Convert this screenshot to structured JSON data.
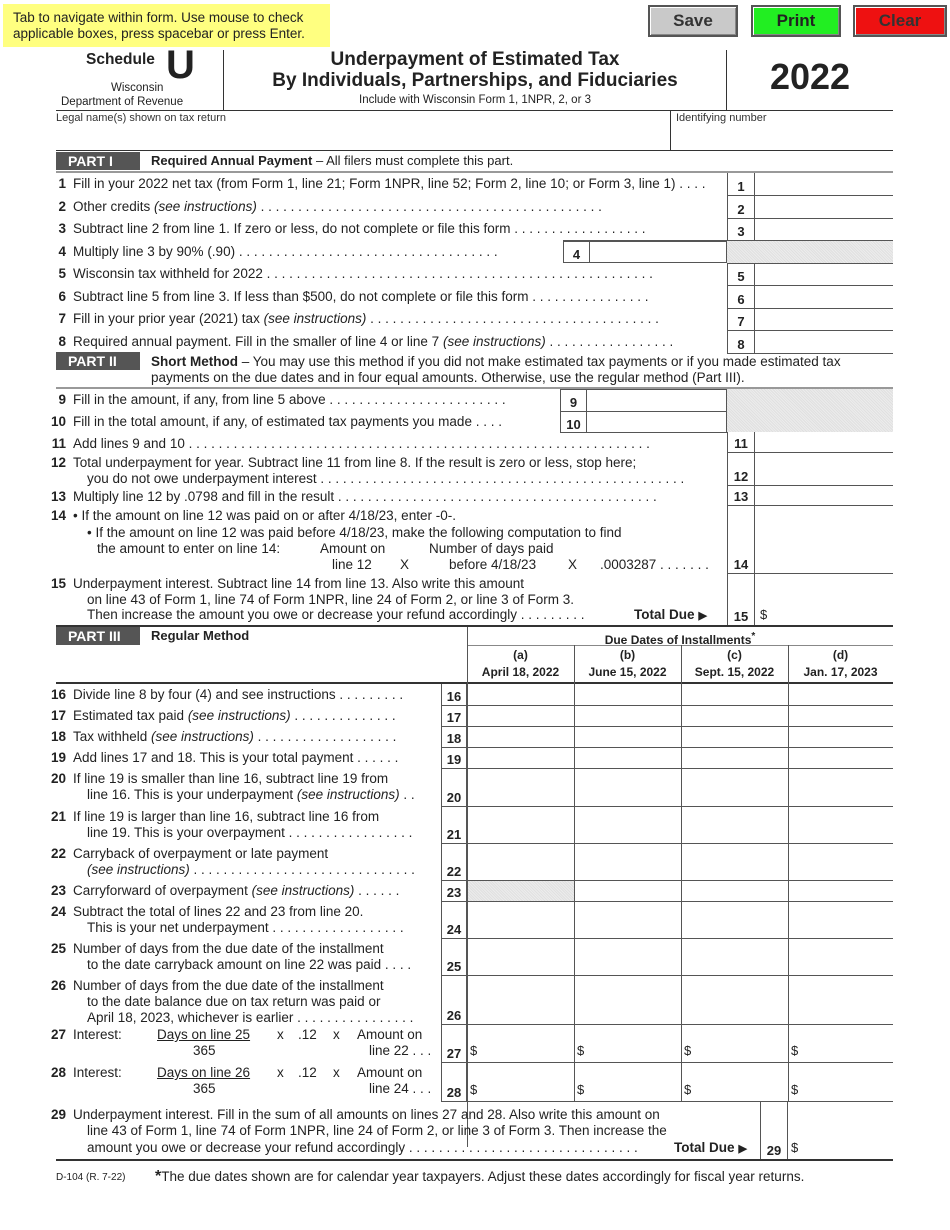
{
  "banner": "Tab to navigate within form. Use mouse to check applicable boxes, press spacebar or press Enter.",
  "buttons": {
    "save": "Save",
    "print": "Print",
    "clear": "Clear"
  },
  "buttonColors": {
    "save": "#c9c9c9",
    "print": "#22ee22",
    "clear": "#ee1111"
  },
  "header": {
    "schedule_word": "Schedule",
    "schedule_letter": "U",
    "state": "Wisconsin",
    "department": "Department of Revenue",
    "title_line1": "Underpayment of Estimated Tax",
    "title_line2": "By Individuals, Partnerships, and Fiduciaries",
    "subtitle": "Include with Wisconsin Form 1, 1NPR, 2, or 3",
    "year": "2022"
  },
  "fields": {
    "legal_name_label": "Legal name(s) shown on tax return",
    "legal_name_value": "",
    "id_label": "Identifying number",
    "id_value": ""
  },
  "part1": {
    "tag": "PART I",
    "title_bold": "Required Annual Payment",
    "title_rest": " – All filers must complete this part.",
    "lines": [
      {
        "num": "1",
        "text": "Fill in your 2022 net tax (from Form 1, line 21; Form 1NPR, line 52; Form 2, line 10; or Form 3, line 1) . . . .",
        "value": ""
      },
      {
        "num": "2",
        "text": "Other credits ",
        "italic": "(see instructions)",
        "dots": " . . . . . . . . . . . . . . . . . . . . . . . . . . . . . . . . . . . . . . . . . . . . . .",
        "value": ""
      },
      {
        "num": "3",
        "text": "Subtract line 2 from line 1.  If zero or less, do not complete or file this form  . . . . . . . . . . . . . . . . . .",
        "value": ""
      },
      {
        "num": "4",
        "text": "Multiply line 3 by 90% (.90) . . . . . . . . . . . . . . . . . . . . . . . . . . . . . . . . . . .",
        "value": ""
      },
      {
        "num": "5",
        "text": "Wisconsin tax withheld for 2022 . . . . . . . . . . . . . . . . . . . . . . . . . . . . . . . . . . . . . . . . . . . . . . . . . . . .",
        "value": ""
      },
      {
        "num": "6",
        "text": "Subtract line 5 from line 3.  If less than $500, do not complete or file this form  . . . . . . . . . . . . . . . .",
        "value": ""
      },
      {
        "num": "7",
        "text": "Fill in your prior year (2021) tax ",
        "italic": "(see instructions)",
        "dots": "  . . . . . . . . . . . . . . . . . . . . . . . . . . . . . . . . . . . . . . .",
        "value": ""
      },
      {
        "num": "8",
        "text": "Required annual payment.  Fill in the smaller of line 4 or line 7 ",
        "italic": "(see instructions)",
        "dots": " . . . . . . . . . . . . . . . . .",
        "value": ""
      }
    ]
  },
  "part2": {
    "tag": "PART II",
    "title_bold": "Short Method",
    "title_rest1": " – You may use this method if you did not make estimated tax payments or if you made estimated tax",
    "title_rest2": "payments on the due dates and in four equal amounts.  Otherwise, use the regular method (Part III).",
    "lines": [
      {
        "num": "9",
        "text": "Fill in the amount, if any, from line 5 above . . . . . . . . . . . . . . . . . . . . . . . .",
        "value": ""
      },
      {
        "num": "10",
        "text": "Fill in the total amount, if any, of estimated tax payments you made  . . . .",
        "value": ""
      },
      {
        "num": "11",
        "text": "Add lines 9 and 10  . . . . . . . . . . . . . . . . . . . . . . . . . . . . . . . . . . . . . . . . . . . . . . . . . . . . . . . . . . . . . .",
        "value": ""
      },
      {
        "num": "12",
        "text": "Total underpayment for year. Subtract line 11 from line 8. If the result is zero or less, stop here;",
        "text2": "you do not owe underpayment interest . . . . . . . . . . . . . . . . . . . . . . . . . . . . . . . . . . . . . . . . . . . . . . . . .",
        "value": ""
      },
      {
        "num": "13",
        "text": "Multiply line 12 by .0798 and fill in the result  . . . . . . . . . . . . . . . . . . . . . . . . . . . . . . . . . . . . . . . . . . .",
        "value": ""
      },
      {
        "num": "14",
        "bullet1": "• If the amount on line 12 was paid on or after 4/18/23, enter -0-.",
        "bullet2": "• If the amount on line 12 was paid before 4/18/23, make the following computation to find",
        "bullet2b": "the amount to enter on line 14:",
        "calc_amount_top": "Amount on",
        "calc_amount_bottom": "line 12",
        "calc_x1": "X",
        "calc_days_top": "Number of days paid",
        "calc_days_bottom": "before 4/18/23",
        "calc_x2": "X",
        "calc_rate": ".0003287  . . . . . . .",
        "value": ""
      },
      {
        "num": "15",
        "text": "Underpayment interest. Subtract line 14 from line 13. Also write this amount",
        "text2": "on line 43 of Form 1, line 74 of Form 1NPR, line 24 of Form 2, or line 3 of Form 3.",
        "text3": "Then increase the amount you owe or decrease your refund accordingly  . . . . . . . . .",
        "total_due": "Total Due",
        "dollar": "$",
        "value": ""
      }
    ]
  },
  "part3": {
    "tag": "PART III",
    "title": "Regular Method",
    "due_dates_header": "Due Dates of Installments",
    "asterisk": "*",
    "columns": [
      {
        "letter": "(a)",
        "date": "April 18, 2022"
      },
      {
        "letter": "(b)",
        "date": "June 15, 2022"
      },
      {
        "letter": "(c)",
        "date": "Sept. 15, 2022"
      },
      {
        "letter": "(d)",
        "date": "Jan. 17, 2023"
      }
    ],
    "lines": [
      {
        "num": "16",
        "text": "Divide line 8 by four (4) and see instructions . . . . . . . . ."
      },
      {
        "num": "17",
        "text": "Estimated tax paid ",
        "italic": "(see instructions)",
        "dots": "  . . . . . . . . . . . . . ."
      },
      {
        "num": "18",
        "text": "Tax withheld ",
        "italic": "(see instructions)",
        "dots": " . . . . . . . . . . . . . . . . . . ."
      },
      {
        "num": "19",
        "text": "Add lines 17 and 18. This is your total payment  . . . . . ."
      },
      {
        "num": "20",
        "text": "If line 19 is smaller than line 16, subtract line 19 from",
        "text2": "line 16. This is your underpayment ",
        "italic2": "(see instructions)",
        "dots2": " . ."
      },
      {
        "num": "21",
        "text": "If line 19 is larger than line 16, subtract line 16 from",
        "text2": "line 19. This is your overpayment  . . . . . . . . . . . . . . . . ."
      },
      {
        "num": "22",
        "text": "Carryback of overpayment or late payment",
        "italic2": "(see instructions)",
        "dots2": " . . . . . . . . . . . . . . . . . . . . . . . . . . . . . ."
      },
      {
        "num": "23",
        "text": "Carryforward of overpayment ",
        "italic": "(see instructions)",
        "dots": " . . . . . ."
      },
      {
        "num": "24",
        "text": "Subtract the total of lines 22 and 23 from line 20.",
        "text2": "This is your net underpayment  . . . . . . . . . . . . . . . . . ."
      },
      {
        "num": "25",
        "text": "Number of days from the due date of the installment",
        "text2": "to the date carryback amount on line 22 was paid  . . . ."
      },
      {
        "num": "26",
        "text": "Number of days from the due date of the installment",
        "text2": "to the date balance due on tax return was paid or",
        "text3": "April 18, 2023, whichever is earlier . . . . . . . . . . . . . . . ."
      },
      {
        "num": "27",
        "label": "Interest:",
        "frac_top": "Days on line 25",
        "frac_bottom": "365",
        "x1": "x",
        "rate": ".12",
        "x2": "x",
        "amt_top": "Amount on",
        "amt_bottom": "line 22 . . .",
        "dollar": "$"
      },
      {
        "num": "28",
        "label": "Interest:",
        "frac_top": "Days on line 26",
        "frac_bottom": "365",
        "x1": "x",
        "rate": ".12",
        "x2": "x",
        "amt_top": "Amount on",
        "amt_bottom": "line 24 . . .",
        "dollar": "$"
      },
      {
        "num": "29",
        "text": "Underpayment interest. Fill in the sum of all amounts on lines 27 and 28. Also write this amount on",
        "text2": "line 43 of Form 1, line 74 of Form 1NPR, line 24 of Form 2, or line 3 of Form 3. Then increase the",
        "text3": "amount you owe or decrease your refund accordingly  . . . . . . . . . . . . . . . . . . . . . . . . . . . . . . .",
        "total_due": "Total Due",
        "dollar": "$"
      }
    ]
  },
  "footer": {
    "code": "D-104 (R. 7-22)",
    "asterisk": "*",
    "note": "The due dates shown are for calendar year taxpayers. Adjust these dates accordingly for fiscal year returns."
  }
}
